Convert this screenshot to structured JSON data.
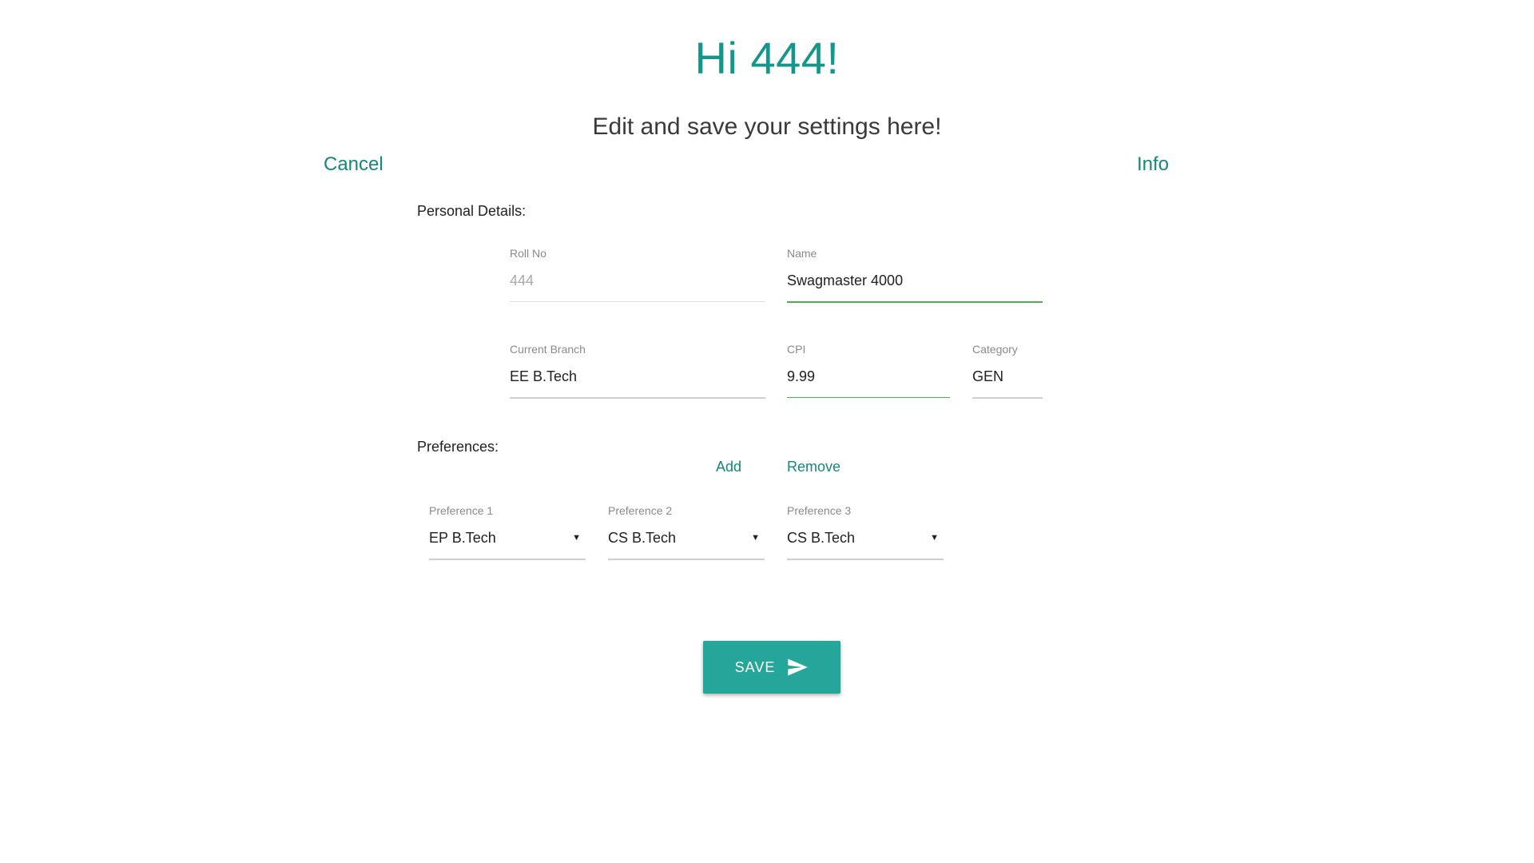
{
  "header": {
    "greeting": "Hi 444!",
    "subtitle": "Edit and save your settings here!"
  },
  "nav": {
    "cancel": "Cancel",
    "info": "Info"
  },
  "personal": {
    "section_label": "Personal Details:",
    "roll_no": {
      "label": "Roll No",
      "value": "444"
    },
    "name": {
      "label": "Name",
      "value": "Swagmaster 4000"
    },
    "branch": {
      "label": "Current Branch",
      "value": "EE B.Tech"
    },
    "cpi": {
      "label": "CPI",
      "value": "9.99"
    },
    "category": {
      "label": "Category",
      "value": "GEN"
    }
  },
  "preferences": {
    "section_label": "Preferences:",
    "add": "Add",
    "remove": "Remove",
    "items": [
      {
        "label": "Preference 1",
        "value": "EP B.Tech"
      },
      {
        "label": "Preference 2",
        "value": "CS B.Tech"
      },
      {
        "label": "Preference 3",
        "value": "CS B.Tech"
      }
    ],
    "dropdown_arrow": "▼"
  },
  "actions": {
    "save": "SAVE",
    "save_icon": "send-icon"
  },
  "colors": {
    "accent": "#15968a",
    "button": "#26a69a",
    "focus_underline": "#4caf50"
  }
}
